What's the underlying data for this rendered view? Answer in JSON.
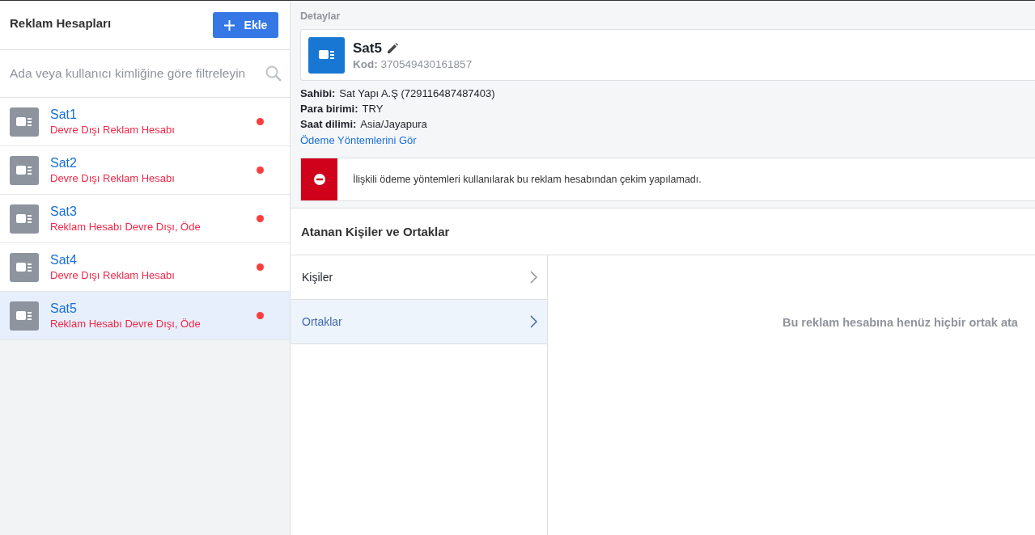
{
  "sidebar": {
    "title": "Reklam Hesapları",
    "add_button": "Ekle",
    "search": {
      "placeholder": "Ada veya kullanıcı kimliğine göre filtreleyin"
    },
    "items": [
      {
        "name": "Sat1",
        "status": "Devre Dışı Reklam Hesabı",
        "selected": false
      },
      {
        "name": "Sat2",
        "status": "Devre Dışı Reklam Hesabı",
        "selected": false
      },
      {
        "name": "Sat3",
        "status": "Reklam Hesabı Devre Dışı, Öde",
        "selected": false
      },
      {
        "name": "Sat4",
        "status": "Devre Dışı Reklam Hesabı",
        "selected": false
      },
      {
        "name": "Sat5",
        "status": "Reklam Hesabı Devre Dışı, Öde",
        "selected": true
      }
    ]
  },
  "details": {
    "section_title": "Detaylar",
    "account_name": "Sat5",
    "code_label": "Kod:",
    "code_value": "370549430161857",
    "fields": [
      {
        "label": "Sahibi:",
        "value": "Sat Yapı A.Ş (729116487487403)"
      },
      {
        "label": "Para birimi:",
        "value": "TRY"
      },
      {
        "label": "Saat dilimi:",
        "value": "Asia/Jayapura"
      }
    ],
    "link": "Ödeme Yöntemlerini Gör",
    "alert": "İlişkili ödeme yöntemleri kullanılarak bu reklam hesabından çekim yapılamadı."
  },
  "assigned": {
    "title": "Atanan Kişiler ve Ortaklar",
    "tabs": [
      {
        "label": "Kişiler",
        "selected": false
      },
      {
        "label": "Ortaklar",
        "selected": true
      }
    ],
    "empty_message": "Bu reklam hesabına henüz hiçbir ortak ata"
  }
}
